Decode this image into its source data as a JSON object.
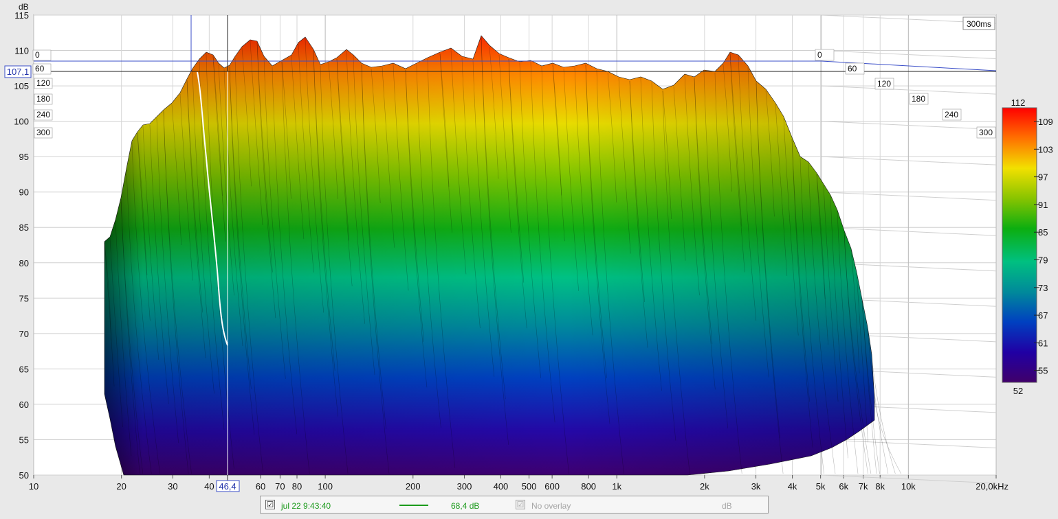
{
  "chart_data": {
    "type": "waterfall",
    "yunit": "dB",
    "yticks": [
      115,
      110,
      105,
      100,
      95,
      90,
      85,
      80,
      75,
      70,
      65,
      60,
      55,
      50
    ],
    "ylim": [
      50,
      115
    ],
    "xticks": [
      "10",
      "20",
      "30",
      "40",
      "60",
      "70",
      "80",
      "100",
      "200",
      "300",
      "400",
      "500",
      "600",
      "800",
      "1k",
      "2k",
      "3k",
      "4k",
      "5k",
      "6k",
      "7k",
      "8k",
      "10k",
      "20,0kHz"
    ],
    "xlim_hz": [
      10,
      20000
    ],
    "time_window_label": "300ms",
    "time_ticks_left": [
      "0",
      "60",
      "120",
      "180",
      "240",
      "300"
    ],
    "time_ticks_right": [
      "0",
      "60",
      "120",
      "180",
      "240",
      "300"
    ],
    "cursor": {
      "y_readout": "107,1",
      "x_readout": "46,4"
    },
    "colorbar": {
      "max_label": "112",
      "min_label": "52",
      "ticks": [
        "109",
        "103",
        "97",
        "91",
        "85",
        "79",
        "73",
        "67",
        "61",
        "55"
      ],
      "colors": [
        "#ff1a00",
        "#ff8000",
        "#f0e000",
        "#90c800",
        "#10b010",
        "#00c080",
        "#008c9c",
        "#004cc0",
        "#1a00a0",
        "#3a006a"
      ]
    }
  },
  "legend": {
    "measurement_label": "jul 22 9:43:40",
    "measurement_checked": "☑",
    "level": "68,4 dB",
    "overlay_label": "No overlay",
    "overlay_checked": "☑",
    "unit": "dB"
  }
}
